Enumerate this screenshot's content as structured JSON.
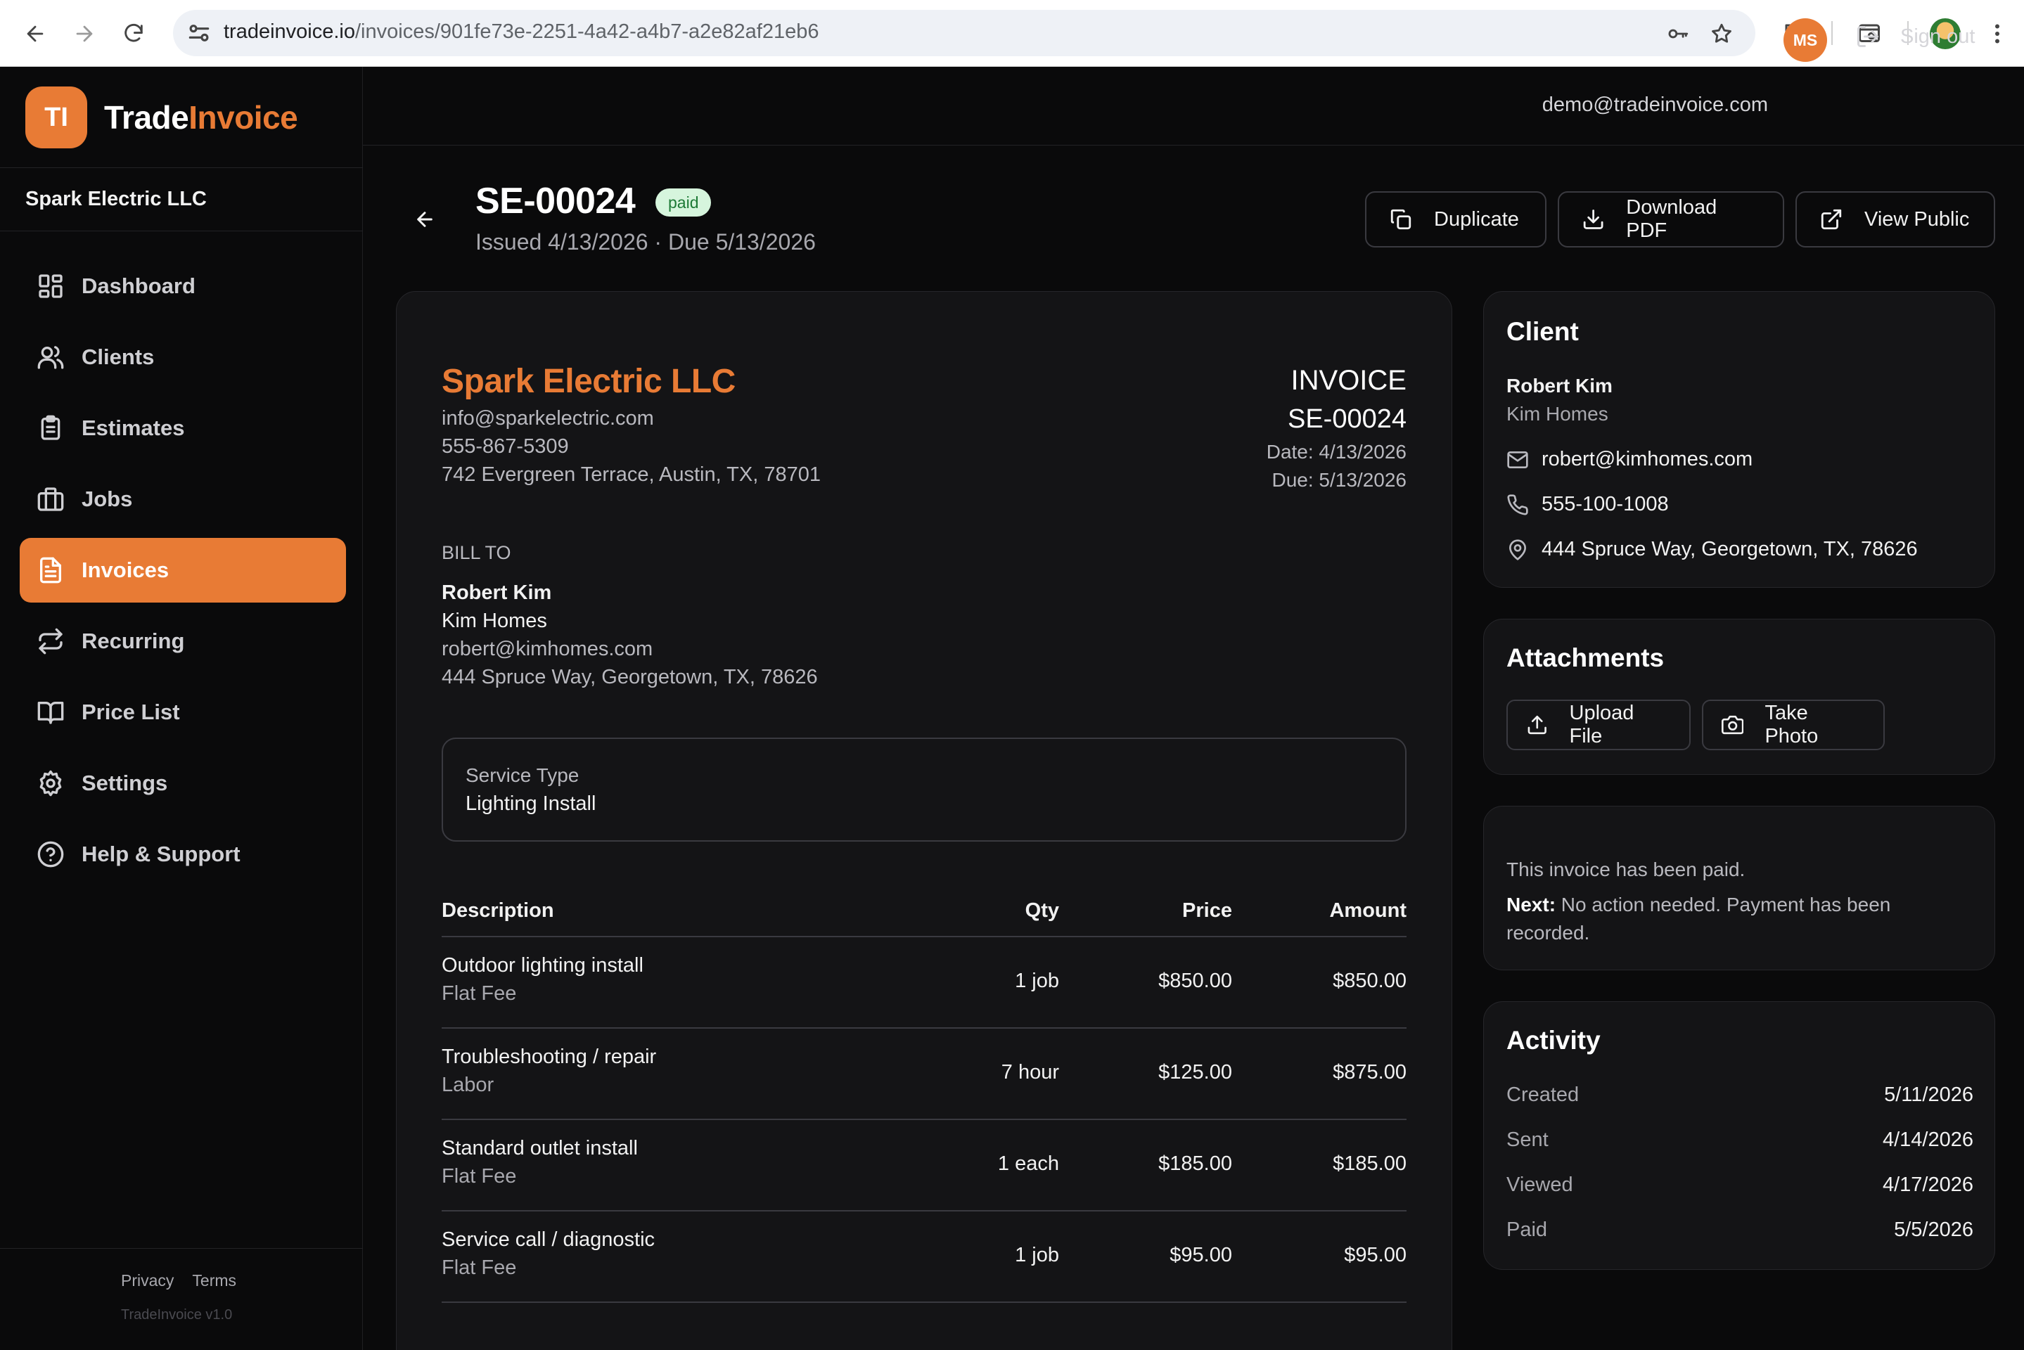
{
  "browser": {
    "url_host": "tradeinvoice.io",
    "url_path": "/invoices/901fe73e-2251-4a42-a4b7-a2e82af21eb6"
  },
  "brand": {
    "logo_initials": "TI",
    "name_part1": "Trade",
    "name_part2": "Invoice",
    "accent_color": "#e87b35"
  },
  "sidebar": {
    "company": "Spark Electric LLC",
    "items": [
      {
        "label": "Dashboard",
        "icon": "dashboard-icon"
      },
      {
        "label": "Clients",
        "icon": "users-icon"
      },
      {
        "label": "Estimates",
        "icon": "clipboard-icon"
      },
      {
        "label": "Jobs",
        "icon": "briefcase-icon"
      },
      {
        "label": "Invoices",
        "icon": "file-text-icon",
        "active": true
      },
      {
        "label": "Recurring",
        "icon": "repeat-icon"
      },
      {
        "label": "Price List",
        "icon": "book-icon"
      },
      {
        "label": "Settings",
        "icon": "gear-icon"
      },
      {
        "label": "Help & Support",
        "icon": "help-circle-icon"
      }
    ],
    "footer": {
      "privacy": "Privacy",
      "terms": "Terms",
      "version": "TradeInvoice v1.0"
    }
  },
  "topbar": {
    "email": "demo@tradeinvoice.com",
    "avatar_initials": "MS",
    "sign_out": "Sign out"
  },
  "header": {
    "invoice_number": "SE-00024",
    "status": "paid",
    "issued_line": "Issued 4/13/2026 · Due 5/13/2026",
    "buttons": {
      "duplicate": "Duplicate",
      "download": "Download PDF",
      "view_public": "View Public"
    }
  },
  "invoice": {
    "from": {
      "name": "Spark Electric LLC",
      "email": "info@sparkelectric.com",
      "phone": "555-867-5309",
      "address": "742 Evergreen Terrace, Austin, TX, 78701"
    },
    "label": "INVOICE",
    "number": "SE-00024",
    "date": "Date: 4/13/2026",
    "due": "Due: 5/13/2026",
    "bill_to": {
      "label": "BILL TO",
      "name": "Robert Kim",
      "company": "Kim Homes",
      "email": "robert@kimhomes.com",
      "address": "444 Spruce Way, Georgetown, TX, 78626"
    },
    "service": {
      "label": "Service Type",
      "value": "Lighting Install"
    },
    "columns": {
      "description": "Description",
      "qty": "Qty",
      "price": "Price",
      "amount": "Amount"
    },
    "lines": [
      {
        "description": "Outdoor lighting install",
        "type": "Flat Fee",
        "qty": "1 job",
        "price": "$850.00",
        "amount": "$850.00"
      },
      {
        "description": "Troubleshooting / repair",
        "type": "Labor",
        "qty": "7 hour",
        "price": "$125.00",
        "amount": "$875.00"
      },
      {
        "description": "Standard outlet install",
        "type": "Flat Fee",
        "qty": "1 each",
        "price": "$185.00",
        "amount": "$185.00"
      },
      {
        "description": "Service call / diagnostic",
        "type": "Flat Fee",
        "qty": "1 job",
        "price": "$95.00",
        "amount": "$95.00"
      }
    ]
  },
  "client_panel": {
    "title": "Client",
    "name": "Robert Kim",
    "company": "Kim Homes",
    "email": "robert@kimhomes.com",
    "phone": "555-100-1008",
    "address": "444 Spruce Way, Georgetown, TX, 78626"
  },
  "attachments": {
    "title": "Attachments",
    "upload": "Upload File",
    "photo": "Take Photo"
  },
  "status_panel": {
    "line1": "This invoice has been paid.",
    "next_label": "Next:",
    "next_text": " No action needed. Payment has been recorded."
  },
  "activity": {
    "title": "Activity",
    "rows": [
      {
        "label": "Created",
        "value": "5/11/2026"
      },
      {
        "label": "Sent",
        "value": "4/14/2026"
      },
      {
        "label": "Viewed",
        "value": "4/17/2026"
      },
      {
        "label": "Paid",
        "value": "5/5/2026"
      }
    ]
  }
}
